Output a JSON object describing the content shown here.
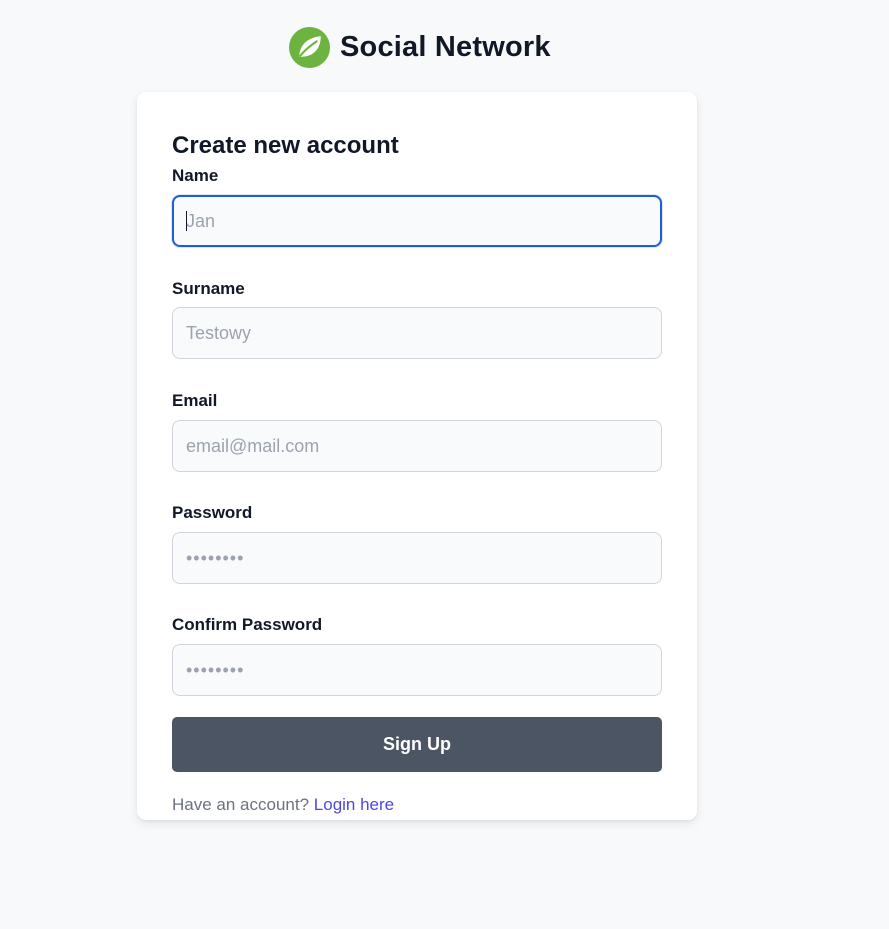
{
  "brand": {
    "name": "Social Network",
    "logo_icon": "leaf-icon",
    "logo_color": "#6db33f"
  },
  "form": {
    "title": "Create new account",
    "fields": [
      {
        "label": "Name",
        "placeholder": "Jan",
        "type": "text",
        "focused": true
      },
      {
        "label": "Surname",
        "placeholder": "Testowy",
        "type": "text"
      },
      {
        "label": "Email",
        "placeholder": "email@mail.com",
        "type": "email"
      },
      {
        "label": "Password",
        "placeholder": "••••••••",
        "type": "password"
      },
      {
        "label": "Confirm Password",
        "placeholder": "••••••••",
        "type": "password"
      }
    ],
    "submit_label": "Sign Up",
    "footer": {
      "prompt": "Have an account?",
      "link_label": "Login here"
    }
  },
  "colors": {
    "background": "#f8f9fb",
    "button": "#4b5563",
    "focus_ring": "#1d5fd6",
    "link": "#4f46e5"
  }
}
